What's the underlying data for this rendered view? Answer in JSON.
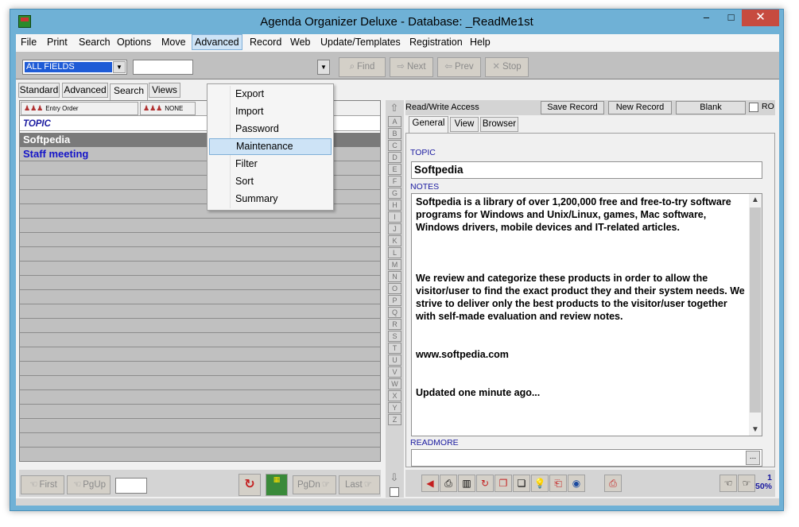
{
  "window": {
    "title": "Agenda Organizer Deluxe - Database: _ReadMe1st",
    "min": "–",
    "max": "□",
    "close": "✕"
  },
  "menu": [
    "File",
    "Print",
    "Search",
    "Options",
    "Move",
    "Advanced",
    "Record",
    "Web",
    "Update/Templates",
    "Registration",
    "Help"
  ],
  "advanced_menu": [
    "Export",
    "Import",
    "Password",
    "Maintenance",
    "Filter",
    "Sort",
    "Summary"
  ],
  "toolbar": {
    "field_select": "ALL FIELDS",
    "find": "Find",
    "next": "Next",
    "prev": "Prev",
    "stop": "Stop"
  },
  "left_tabs": [
    "Standard",
    "Advanced",
    "Search",
    "Views"
  ],
  "sort": {
    "entry_order": "Entry Order",
    "none": "NONE"
  },
  "list": {
    "column_header": "TOPIC",
    "rows": [
      "Softpedia",
      "Staff meeting"
    ],
    "selected_index": 0
  },
  "nav": {
    "first": "First",
    "pgup": "PgUp",
    "pgdn": "PgDn",
    "last": "Last"
  },
  "alphabet": [
    "A",
    "B",
    "C",
    "D",
    "E",
    "F",
    "G",
    "H",
    "I",
    "J",
    "K",
    "L",
    "M",
    "N",
    "O",
    "P",
    "Q",
    "R",
    "S",
    "T",
    "U",
    "V",
    "W",
    "X",
    "Y",
    "Z"
  ],
  "record_bar": {
    "access": "Read/Write Access",
    "save": "Save Record",
    "new": "New Record",
    "blank": "Blank",
    "ro": "RO"
  },
  "detail_tabs": [
    "General",
    "View",
    "Browser"
  ],
  "detail": {
    "topic_label": "TOPIC",
    "topic_value": "Softpedia",
    "notes_label": "NOTES",
    "notes": [
      "Softpedia is a library of over 1,200,000 free and free-to-try software programs for Windows and Unix/Linux, games, Mac software,  Windows drivers, mobile devices and IT-related articles.",
      "We review and categorize these products in order to allow the visitor/user to find the exact product they and their system needs. We strive to deliver only the best products to the visitor/user together with self-made evaluation and review notes.",
      "www.softpedia.com",
      "Updated one minute ago..."
    ],
    "readmore_label": "READMORE",
    "readmore_button": "..."
  },
  "record_count": {
    "count": "1",
    "zoom": "50%"
  },
  "colors": {
    "title_bg": "#6fb1d6",
    "close_bg": "#c74b3f",
    "selection": "#1e5bd6",
    "link_blue": "#1414c8"
  }
}
